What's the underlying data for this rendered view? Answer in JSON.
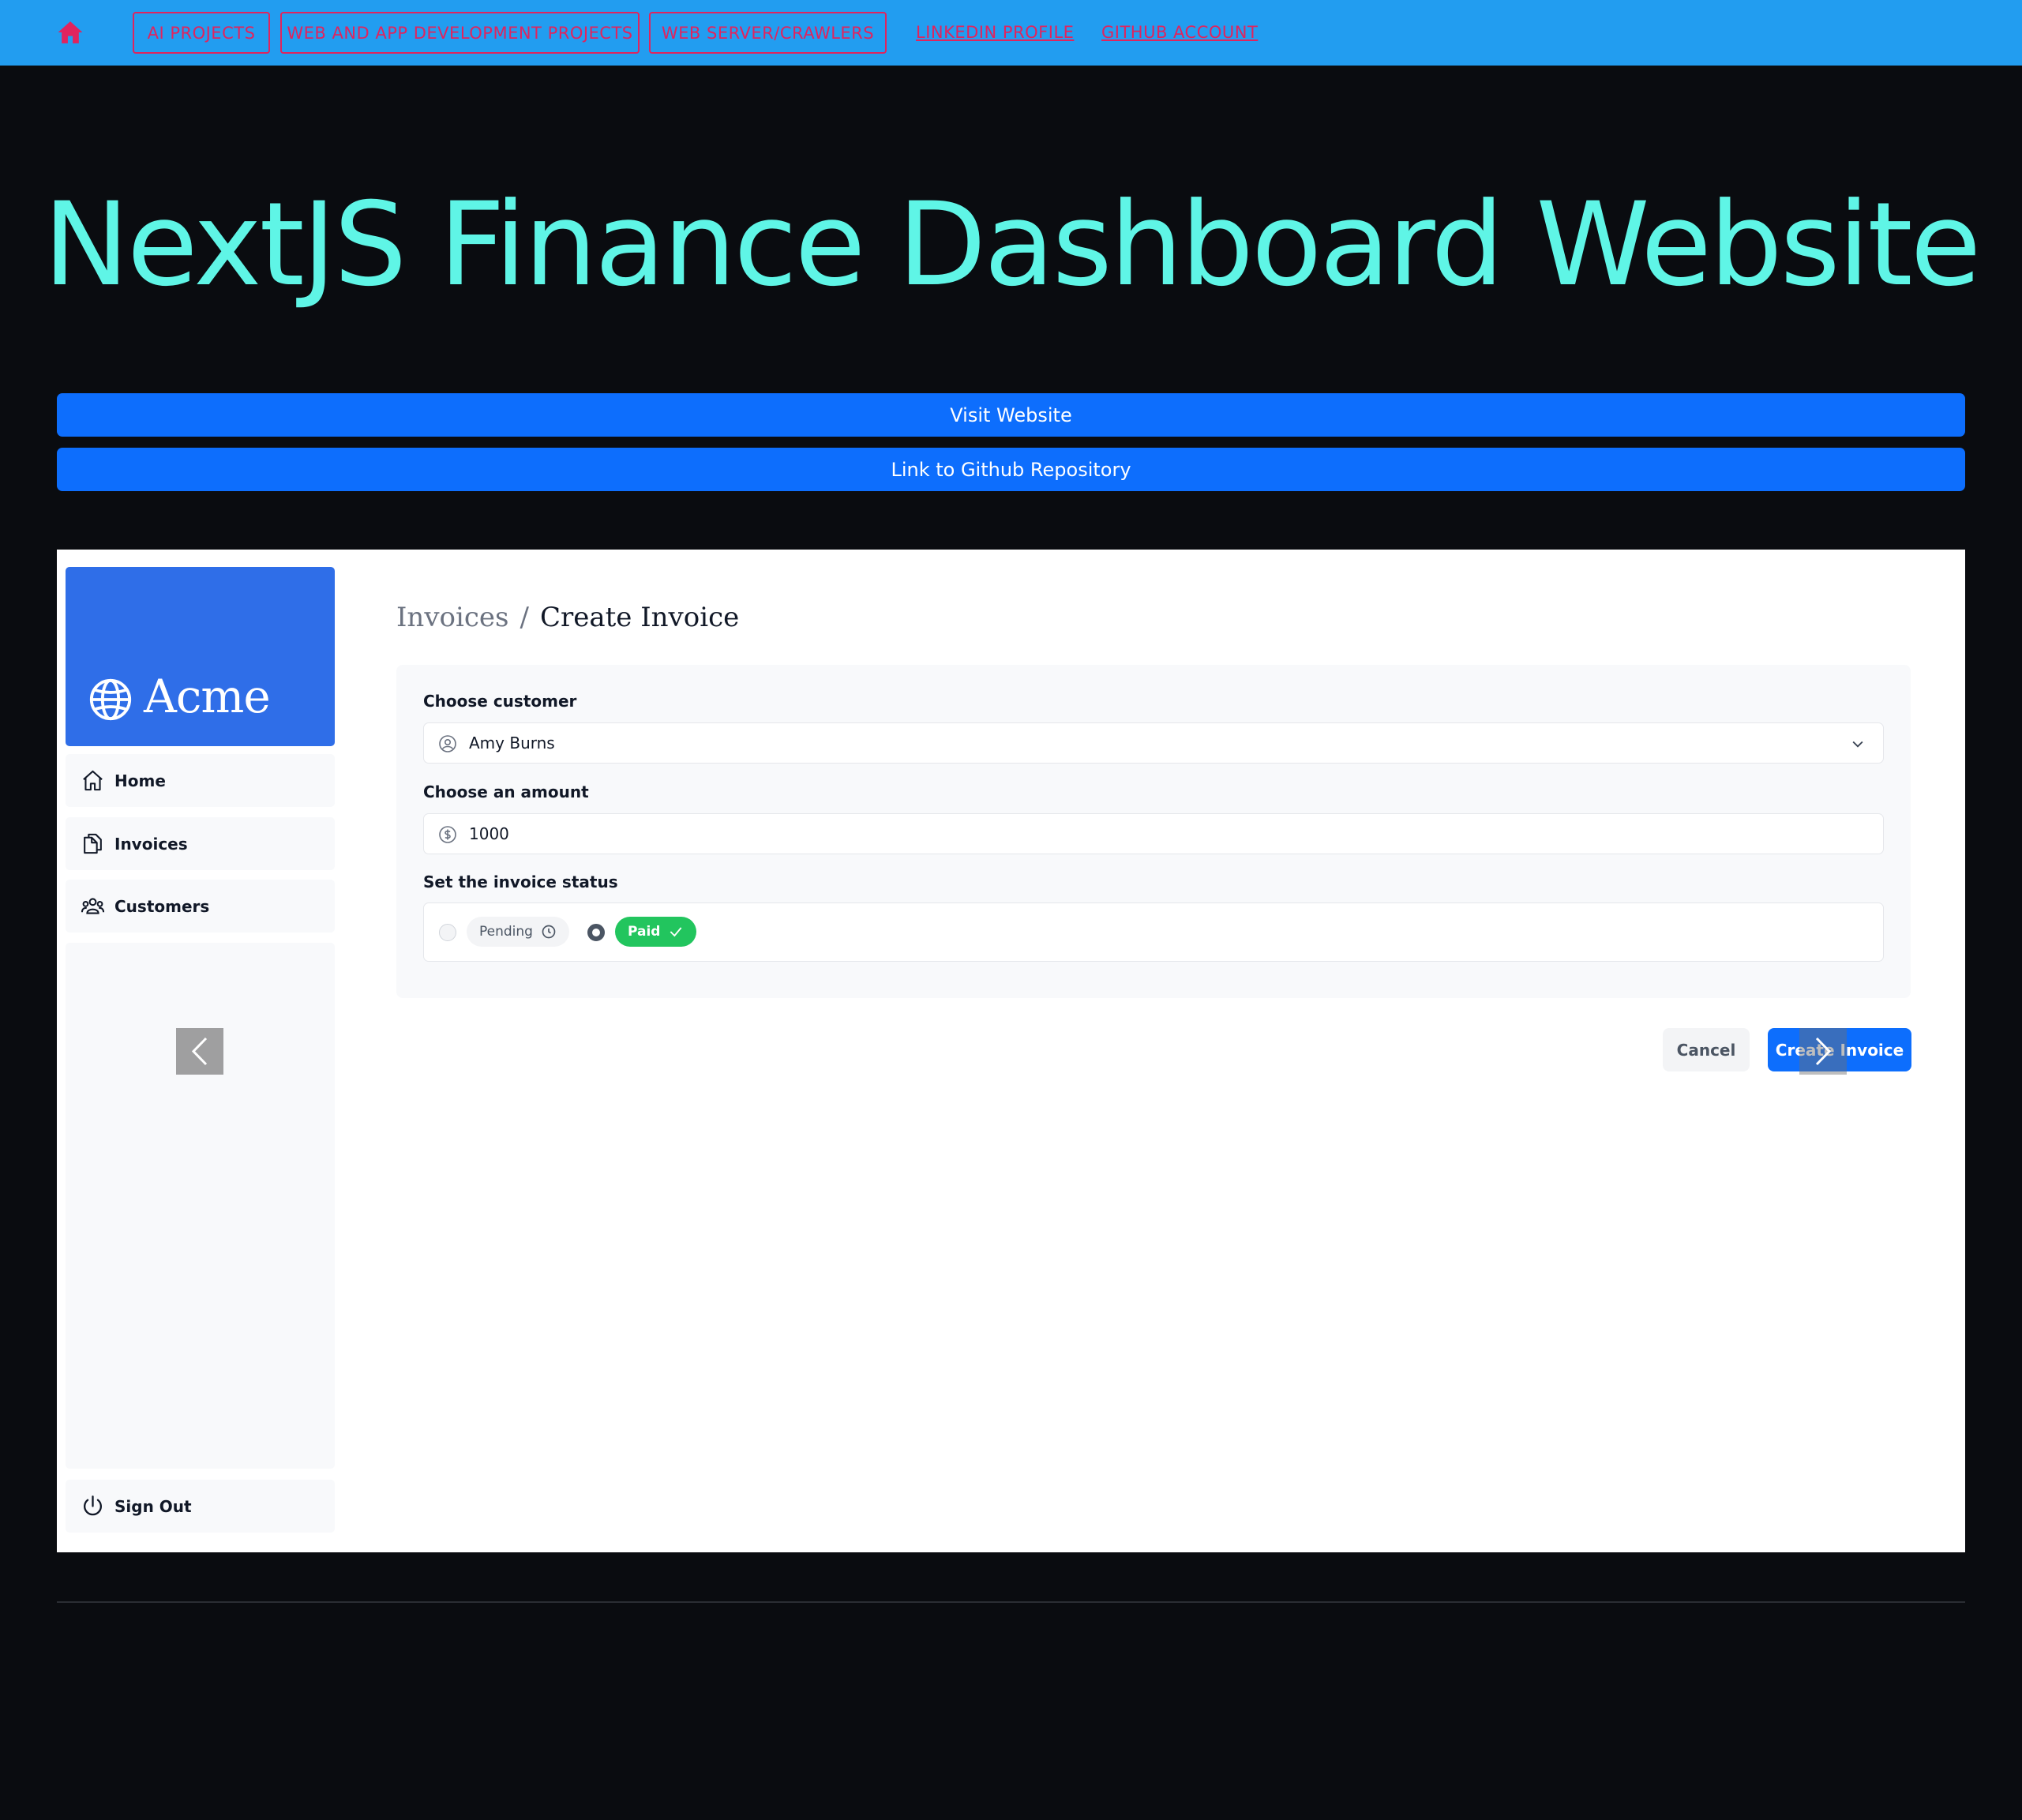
{
  "nav": {
    "home_icon": "home-icon",
    "buttons": [
      "AI PROJECTS",
      "WEB AND APP DEVELOPMENT PROJECTS",
      "WEB SERVER/CRAWLERS"
    ],
    "links": [
      "LINKEDIN PROFILE",
      "GITHUB ACCOUNT"
    ],
    "accent_color": "#e0245e",
    "bar_color": "#229df0"
  },
  "title": "NextJS Finance Dashboard Website",
  "actions": {
    "visit": "Visit Website",
    "repo": "Link to Github Repository"
  },
  "slide": {
    "logo_text": "Acme",
    "sidebar": {
      "items": [
        {
          "label": "Home",
          "icon": "home-icon"
        },
        {
          "label": "Invoices",
          "icon": "document-icon"
        },
        {
          "label": "Customers",
          "icon": "users-icon"
        }
      ],
      "signout": "Sign Out"
    },
    "breadcrumb": {
      "parent": "Invoices",
      "separator": "/",
      "current": "Create Invoice"
    },
    "form": {
      "customer_label": "Choose customer",
      "customer_value": "Amy Burns",
      "amount_label": "Choose an amount",
      "amount_value": "1000",
      "status_label": "Set the invoice status",
      "status_options": [
        "Pending",
        "Paid"
      ],
      "status_selected": "Paid"
    },
    "buttons": {
      "cancel": "Cancel",
      "create": "Create Invoice"
    }
  }
}
